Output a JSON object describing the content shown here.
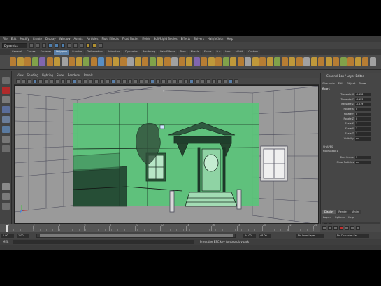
{
  "menubar": [
    "File",
    "Edit",
    "Modify",
    "Create",
    "Display",
    "Window",
    "Assets",
    "Particles",
    "Fluid Effects",
    "Fluid Nodes",
    "Fields",
    "Soft/Rigid Bodies",
    "Effects",
    "Solvers",
    "Hair/nCloth",
    "Help"
  ],
  "mode": "Dynamics",
  "shelf_tabs": [
    "General",
    "Curves",
    "Surfaces",
    "Polygons",
    "Subdivs",
    "Deformation",
    "Animation",
    "Dynamics",
    "Rendering",
    "PaintEffects",
    "Toon",
    "Muscle",
    "Fluids",
    "Fur",
    "Hair",
    "nCloth",
    "Custom"
  ],
  "active_shelf_tab": "Polygons",
  "panel_menu": [
    "View",
    "Shading",
    "Lighting",
    "Show",
    "Renderer",
    "Panels"
  ],
  "channel_box": {
    "title": "Channel Box / Layer Editor",
    "menu": [
      "Channels",
      "Edit",
      "Object",
      "Show"
    ],
    "object": "floor1",
    "attributes": [
      {
        "label": "Translate X",
        "value": "-0.128"
      },
      {
        "label": "Translate Y",
        "value": "-0.123"
      },
      {
        "label": "Translate Z",
        "value": "-0.239"
      },
      {
        "label": "Rotate X",
        "value": "0"
      },
      {
        "label": "Rotate Y",
        "value": "0"
      },
      {
        "label": "Rotate Z",
        "value": "0"
      },
      {
        "label": "Scale X",
        "value": "1"
      },
      {
        "label": "Scale Y",
        "value": "1"
      },
      {
        "label": "Scale Z",
        "value": "1"
      },
      {
        "label": "Visibility",
        "value": "on"
      }
    ],
    "shapes_label": "SHAPES",
    "shape_name": "floorShape1",
    "shape_attrs": [
      {
        "label": "Start Frame",
        "value": "1"
      },
      {
        "label": "Show Particles",
        "value": "on"
      }
    ]
  },
  "layer_tabs": [
    "Display",
    "Render",
    "Anim"
  ],
  "active_layer_tab": "Display",
  "layer_menu": [
    "Layers",
    "Options",
    "Help"
  ],
  "layers": [
    {
      "name": "Facade_Batch",
      "selected": false,
      "v": "V"
    },
    {
      "name": "house",
      "selected": true,
      "v": "V"
    }
  ],
  "timeline": {
    "ticks": [
      "1",
      "2",
      "4",
      "6",
      "8",
      "10",
      "12",
      "14",
      "16",
      "18",
      "20",
      "22",
      "24"
    ],
    "current_frame": "1.00"
  },
  "range": {
    "start": "1.00",
    "start_inner": "1.00",
    "end_inner": "24.00",
    "end": "48.00",
    "anim_layer": "No Anim Layer",
    "char_set": "No Character Set"
  },
  "command_label": "MEL",
  "help_text": "Press the ESC key to stop playback"
}
